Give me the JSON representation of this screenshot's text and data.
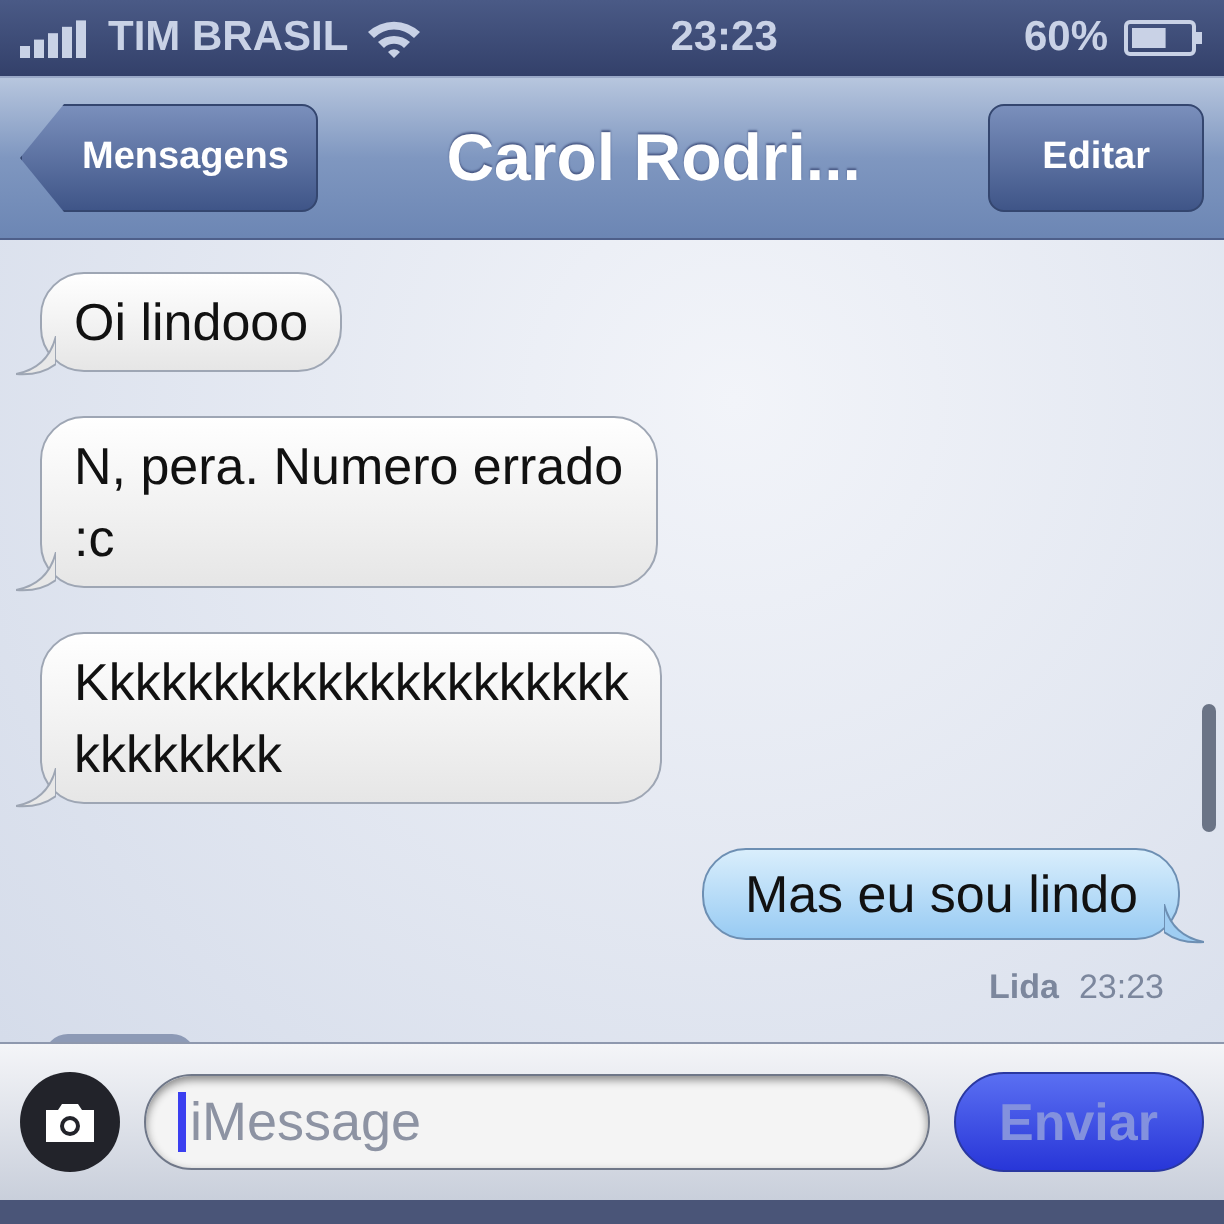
{
  "status_bar": {
    "carrier": "TIM BRASIL",
    "time": "23:23",
    "battery": "60%"
  },
  "nav_bar": {
    "back": "Mensagens",
    "title": "Carol Rodri...",
    "edit": "Editar"
  },
  "messages": [
    {
      "kind": "received",
      "text": "Oi lindooo"
    },
    {
      "kind": "received",
      "text": "N, pera. Numero errado\n:c"
    },
    {
      "kind": "received",
      "text": "Kkkkkkkkkkkkkkkkkkkkk\nkkkkkkkk"
    },
    {
      "kind": "sent",
      "text": "Mas eu sou lindo"
    }
  ],
  "receipt": {
    "status": "Lida",
    "time": "23:23"
  },
  "input_bar": {
    "placeholder": "iMessage",
    "send": "Enviar",
    "send_disabled": true
  }
}
